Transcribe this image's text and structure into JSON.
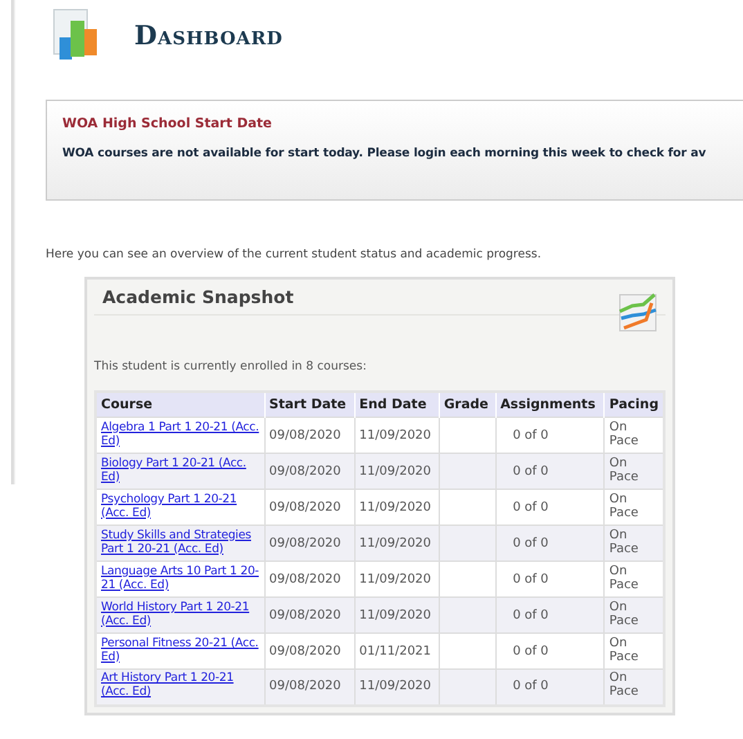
{
  "page": {
    "title": "Dashboard"
  },
  "notice": {
    "title": "WOA High School Start Date",
    "message": "WOA courses are not available for start today. Please login each morning this week to check for av"
  },
  "intro": "Here you can see an overview of the current student status and academic progress.",
  "snapshot": {
    "title": "Academic Snapshot",
    "summary": "This student is currently enrolled in 8 courses:",
    "table": {
      "columns": [
        "Course",
        "Start Date",
        "End Date",
        "Grade",
        "Assignments",
        "Pacing"
      ],
      "rows": [
        {
          "course": "Algebra 1 Part 1 20-21 (Acc. Ed)",
          "start": "09/08/2020",
          "end": "11/09/2020",
          "assignments": "0 of 0",
          "pacing": "On Pace"
        },
        {
          "course": "Biology Part 1 20-21 (Acc. Ed)",
          "start": "09/08/2020",
          "end": "11/09/2020",
          "assignments": "0 of 0",
          "pacing": "On Pace"
        },
        {
          "course": "Psychology Part 1 20-21 (Acc. Ed)",
          "start": "09/08/2020",
          "end": "11/09/2020",
          "assignments": "0 of 0",
          "pacing": "On Pace"
        },
        {
          "course": "Study Skills and Strategies Part 1 20-21 (Acc. Ed)",
          "start": "09/08/2020",
          "end": "11/09/2020",
          "assignments": "0 of 0",
          "pacing": "On Pace"
        },
        {
          "course": "Language Arts 10 Part 1 20-21 (Acc. Ed)",
          "start": "09/08/2020",
          "end": "11/09/2020",
          "assignments": "0 of 0",
          "pacing": "On Pace"
        },
        {
          "course": "World History Part 1 20-21 (Acc. Ed)",
          "start": "09/08/2020",
          "end": "11/09/2020",
          "assignments": "0 of 0",
          "pacing": "On Pace"
        },
        {
          "course": "Personal Fitness 20-21 (Acc. Ed)",
          "start": "09/08/2020",
          "end": "01/11/2021",
          "assignments": "0 of 0",
          "pacing": "On Pace"
        },
        {
          "course": "Art History Part 1 20-21 (Acc. Ed)",
          "start": "09/08/2020",
          "end": "11/09/2020",
          "assignments": "0 of 0",
          "pacing": "On Pace"
        }
      ]
    }
  }
}
